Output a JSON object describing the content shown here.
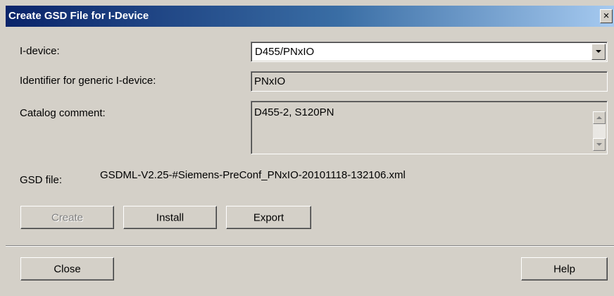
{
  "window": {
    "title": "Create GSD File for I-Device",
    "close_glyph": "×"
  },
  "fields": {
    "idevice_label": "I-device:",
    "idevice_value": "D455/PNxIO",
    "identifier_label": "Identifier for generic I-device:",
    "identifier_value": "PNxIO",
    "catalog_label": "Catalog comment:",
    "catalog_value": "D455-2, S120PN",
    "gsd_label": "GSD file:",
    "gsd_value": "GSDML-V2.25-#Siemens-PreConf_PNxIO-20101118-132106.xml"
  },
  "buttons": {
    "create": "Create",
    "install": "Install",
    "export": "Export",
    "close": "Close",
    "help": "Help"
  },
  "states": {
    "create_enabled": false
  }
}
